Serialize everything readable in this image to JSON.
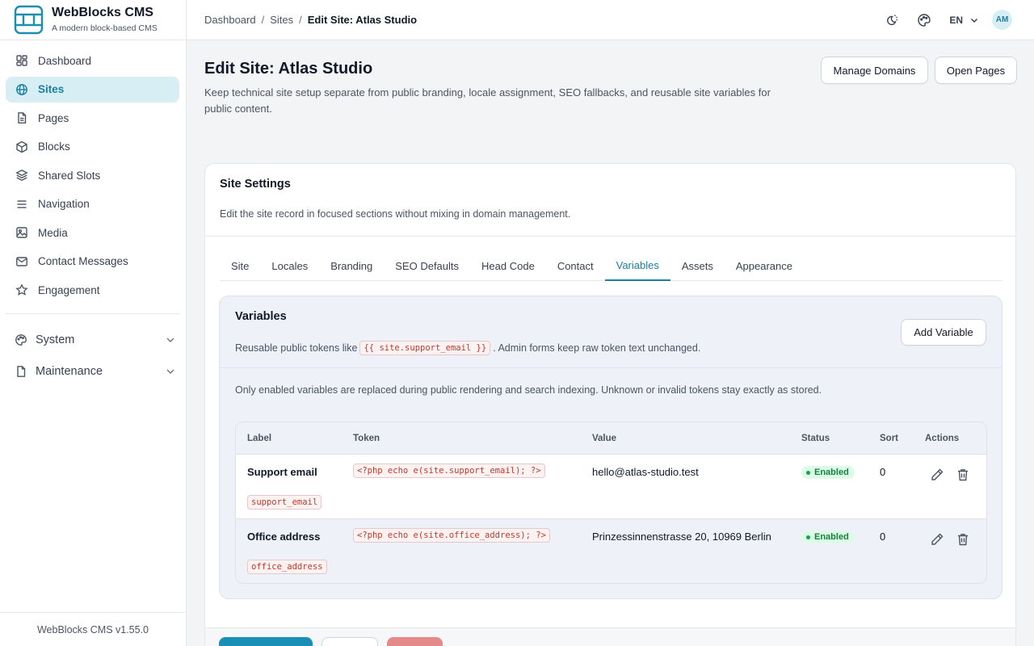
{
  "brand": {
    "title": "WebBlocks CMS",
    "subtitle": "A modern block-based CMS"
  },
  "sidebar": {
    "items": [
      {
        "label": "Dashboard",
        "icon": "dashboard-icon"
      },
      {
        "label": "Sites",
        "icon": "globe-icon",
        "active": true
      },
      {
        "label": "Pages",
        "icon": "document-icon"
      },
      {
        "label": "Blocks",
        "icon": "cube-icon"
      },
      {
        "label": "Shared Slots",
        "icon": "layers-icon"
      },
      {
        "label": "Navigation",
        "icon": "menu-icon"
      },
      {
        "label": "Media",
        "icon": "image-icon"
      },
      {
        "label": "Contact Messages",
        "icon": "mail-icon"
      },
      {
        "label": "Engagement",
        "icon": "star-icon"
      }
    ],
    "groups": [
      {
        "label": "System",
        "icon": "palette-icon"
      },
      {
        "label": "Maintenance",
        "icon": "file-icon"
      }
    ],
    "footer": "WebBlocks CMS v1.55.0"
  },
  "header": {
    "breadcrumb": [
      "Dashboard",
      "Sites"
    ],
    "breadcrumb_sep": "/",
    "breadcrumb_current": "Edit Site: Atlas Studio",
    "language": "EN",
    "avatar": "AM"
  },
  "page": {
    "title": "Edit Site: Atlas Studio",
    "description": "Keep technical site setup separate from public branding, locale assignment, SEO fallbacks, and reusable site variables for public content.",
    "manage_domains": "Manage Domains",
    "open_pages": "Open Pages"
  },
  "card": {
    "title": "Site Settings",
    "description": "Edit the site record in focused sections without mixing in domain management.",
    "tabs": [
      "Site",
      "Locales",
      "Branding",
      "SEO Defaults",
      "Head Code",
      "Contact",
      "Variables",
      "Assets",
      "Appearance"
    ],
    "active_tab": "Variables"
  },
  "variables": {
    "title": "Variables",
    "desc_before": "Reusable public tokens like",
    "desc_token": "{{ site.support_email }}",
    "desc_after": ". Admin forms keep raw token text unchanged.",
    "add_button": "Add Variable",
    "note": "Only enabled variables are replaced during public rendering and search indexing. Unknown or invalid tokens stay exactly as stored.",
    "columns": [
      "Label",
      "Token",
      "Value",
      "Status",
      "Sort",
      "Actions"
    ],
    "rows": [
      {
        "label": "Support email",
        "key": "support_email",
        "token": "<?php echo e(site.support_email); ?>",
        "value": "hello@atlas-studio.test",
        "status": "Enabled",
        "sort": "0"
      },
      {
        "label": "Office address",
        "key": "office_address",
        "token": "<?php echo e(site.office_address); ?>",
        "value": "Prinzessinnenstrasse 20, 10969 Berlin",
        "status": "Enabled",
        "sort": "0"
      }
    ]
  },
  "colors": {
    "accent": "#1a8fb5",
    "accent_bg": "#d8eef5",
    "danger": "#e58a8a",
    "success": "#15803d"
  }
}
